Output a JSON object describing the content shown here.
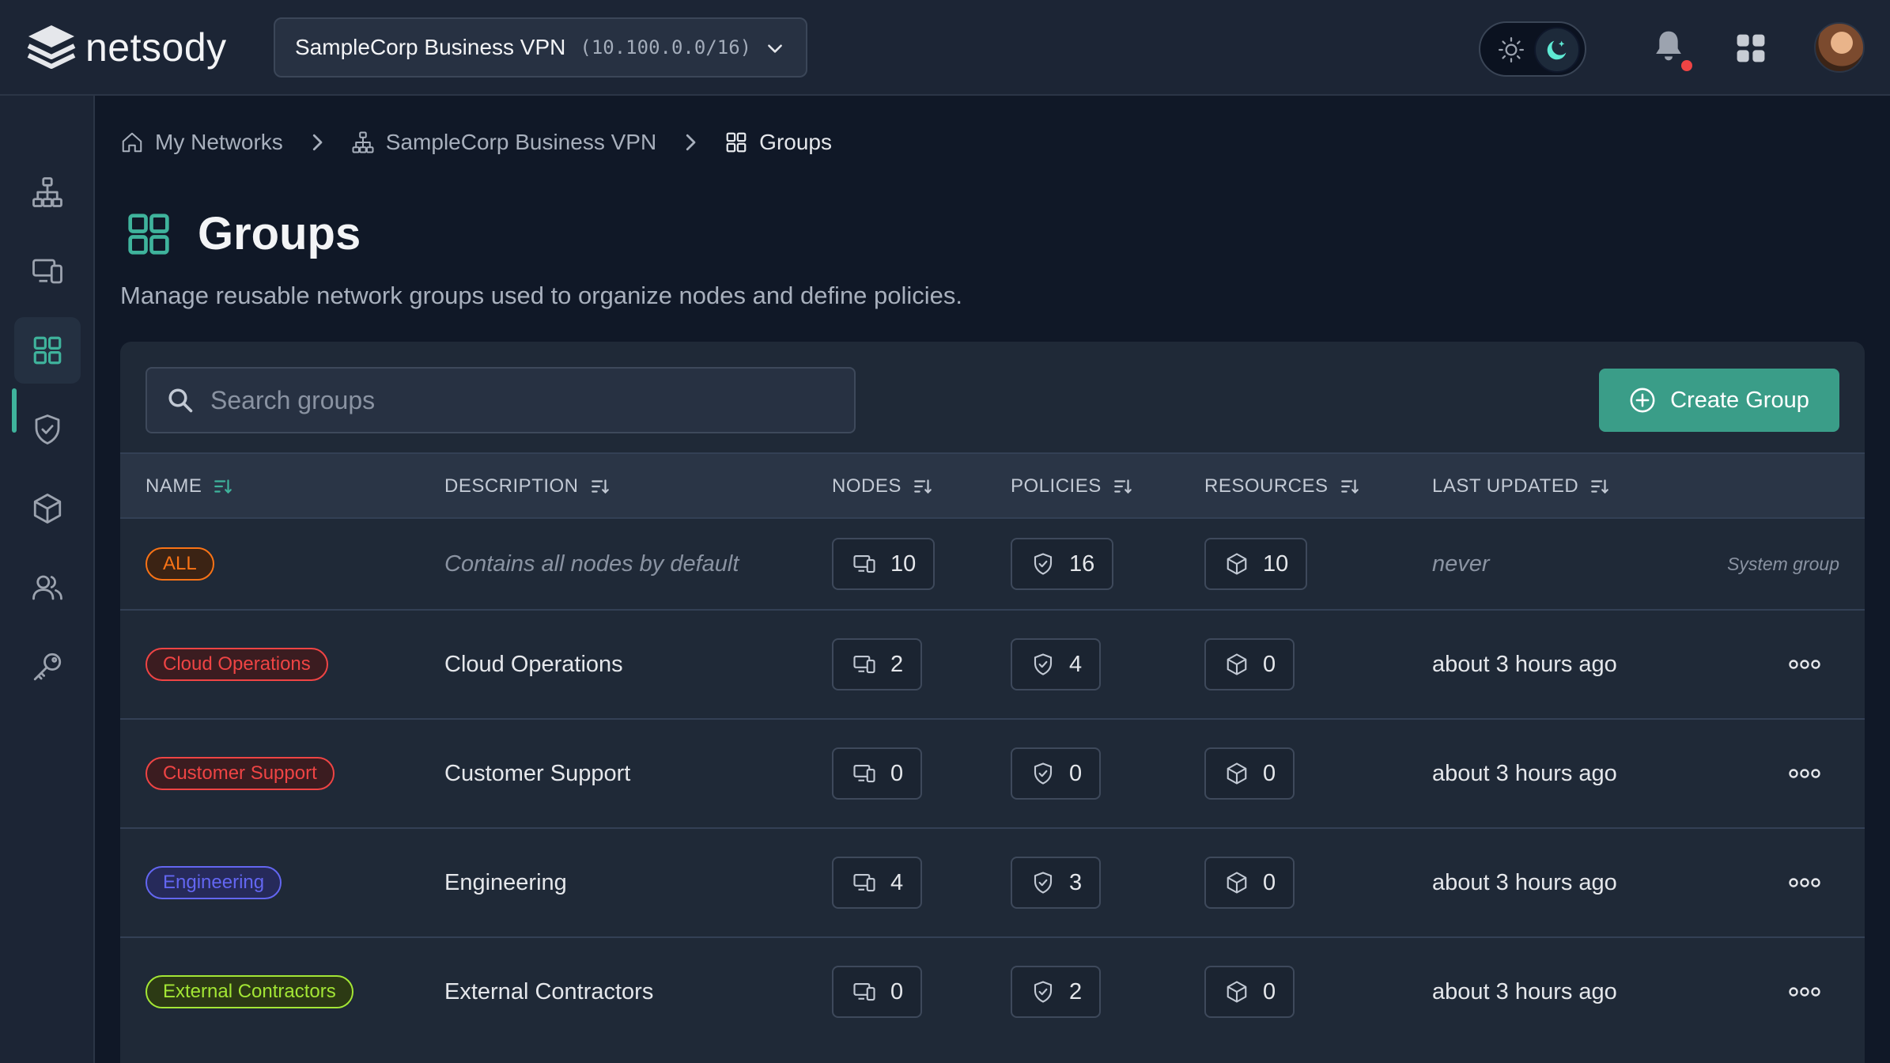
{
  "app": {
    "name": "netsody"
  },
  "network_selector": {
    "name": "SampleCorp Business VPN",
    "cidr": "(10.100.0.0/16)"
  },
  "theme": {
    "mode": "dark"
  },
  "sidebar": {
    "items": [
      {
        "icon": "network-icon"
      },
      {
        "icon": "devices-icon"
      },
      {
        "icon": "groups-icon",
        "active": true
      },
      {
        "icon": "shield-icon"
      },
      {
        "icon": "cube-icon"
      },
      {
        "icon": "users-icon"
      },
      {
        "icon": "key-icon"
      }
    ]
  },
  "breadcrumb": {
    "home": "My Networks",
    "network": "SampleCorp Business VPN",
    "current": "Groups"
  },
  "page": {
    "title": "Groups",
    "subtitle": "Manage reusable network groups used to organize nodes and define policies."
  },
  "toolbar": {
    "search_placeholder": "Search groups",
    "create_label": "Create Group"
  },
  "table": {
    "columns": [
      "NAME",
      "DESCRIPTION",
      "NODES",
      "POLICIES",
      "RESOURCES",
      "LAST UPDATED"
    ],
    "rows": [
      {
        "name": "ALL",
        "description": "Contains all nodes by default",
        "nodes": "10",
        "policies": "16",
        "resources": "10",
        "updated": "never",
        "action": "System group",
        "tag_color": "#f97316",
        "tag_bg": "#3b2314"
      },
      {
        "name": "Cloud Operations",
        "description": "Cloud Operations",
        "nodes": "2",
        "policies": "4",
        "resources": "0",
        "updated": "about 3 hours ago",
        "tag_color": "#ef4444",
        "tag_bg": "#3b1c20"
      },
      {
        "name": "Customer Support",
        "description": "Customer Support",
        "nodes": "0",
        "policies": "0",
        "resources": "0",
        "updated": "about 3 hours ago",
        "tag_color": "#ef4444",
        "tag_bg": "#3b1c20"
      },
      {
        "name": "Engineering",
        "description": "Engineering",
        "nodes": "4",
        "policies": "3",
        "resources": "0",
        "updated": "about 3 hours ago",
        "tag_color": "#6366f1",
        "tag_bg": "#262a5a"
      },
      {
        "name": "External Contractors",
        "description": "External Contractors",
        "nodes": "0",
        "policies": "2",
        "resources": "0",
        "updated": "about 3 hours ago",
        "tag_color": "#a3e635",
        "tag_bg": "#2c3a14"
      }
    ]
  },
  "colors": {
    "accent": "#3a9d88",
    "background": "#101827",
    "panel": "#1f2937"
  }
}
